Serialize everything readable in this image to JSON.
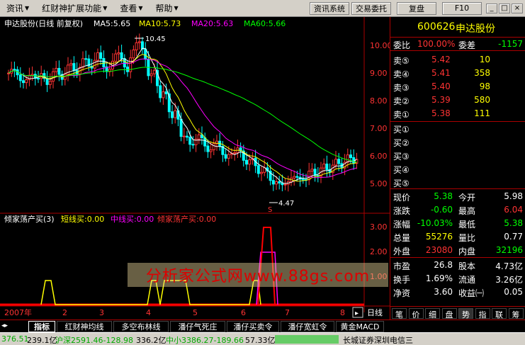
{
  "menu": {
    "items": [
      {
        "label": "资讯",
        "arrow": true
      },
      {
        "label": "红财神扩展功能",
        "arrow": true
      },
      {
        "label": "查看",
        "arrow": true
      },
      {
        "label": "帮助",
        "arrow": true
      }
    ],
    "buttons": [
      "资讯系统",
      "交易委托",
      "复盘",
      "F10"
    ],
    "window_controls": [
      "_",
      "□",
      "×"
    ]
  },
  "chart_header": {
    "title": "申达股份(日线 前复权)",
    "ma5": "MA5:5.65",
    "ma10": "MA10:5.73",
    "ma20": "MA20:5.63",
    "ma60": "MA60:5.66"
  },
  "indicator_header": {
    "name": "倾家荡产买(3)",
    "short": "短线买:0.00",
    "mid": "中线买:0.00",
    "long": "倾家荡产买:0.00"
  },
  "annotations": {
    "high": "10.45",
    "low": "4.47",
    "marker": "S"
  },
  "axis": {
    "price_ticks": [
      "10.00",
      "9.00",
      "8.00",
      "7.00",
      "6.00",
      "5.00"
    ],
    "ind_ticks": [
      "3.00",
      "2.00",
      "1.00"
    ],
    "dates": [
      "2007年",
      "2",
      "3",
      "4",
      "5",
      "6",
      "7",
      "8"
    ],
    "period": "日线"
  },
  "watermark": "分析家公式网www.88gs.com",
  "quote": {
    "code": "600626",
    "name": "申达股份",
    "wei_bi_label": "委比",
    "wei_bi": "100.00%",
    "wei_cha_label": "委差",
    "wei_cha": "-1157",
    "sell": [
      {
        "label": "卖⑤",
        "price": "5.42",
        "vol": "10"
      },
      {
        "label": "卖④",
        "price": "5.41",
        "vol": "358"
      },
      {
        "label": "卖③",
        "price": "5.40",
        "vol": "98"
      },
      {
        "label": "卖②",
        "price": "5.39",
        "vol": "580"
      },
      {
        "label": "卖①",
        "price": "5.38",
        "vol": "111"
      }
    ],
    "buy": [
      {
        "label": "买①"
      },
      {
        "label": "买②"
      },
      {
        "label": "买③"
      },
      {
        "label": "买④"
      },
      {
        "label": "买⑤"
      }
    ],
    "stats": [
      {
        "l1": "现价",
        "v1": "5.38",
        "c1": "#0f0",
        "l2": "今开",
        "v2": "5.98",
        "c2": "#fff"
      },
      {
        "l1": "涨跌",
        "v1": "-0.60",
        "c1": "#0f0",
        "l2": "最高",
        "v2": "6.04",
        "c2": "#f33"
      },
      {
        "l1": "涨幅",
        "v1": "-10.03%",
        "c1": "#0f0",
        "l2": "最低",
        "v2": "5.38",
        "c2": "#0f0"
      },
      {
        "l1": "总量",
        "v1": "55276",
        "c1": "#ff0",
        "l2": "量比",
        "v2": "0.77",
        "c2": "#fff"
      },
      {
        "l1": "外盘",
        "v1": "23080",
        "c1": "#f33",
        "l2": "内盘",
        "v2": "32196",
        "c2": "#0f0"
      }
    ],
    "finance": [
      {
        "l1": "市盈",
        "v1": "26.8",
        "l2": "股本",
        "v2": "4.73亿"
      },
      {
        "l1": "换手",
        "v1": "1.69%",
        "l2": "流通",
        "v2": "3.26亿"
      },
      {
        "l1": "净资",
        "v1": "3.60",
        "l2": "收益㈠",
        "v2": "0.05"
      }
    ]
  },
  "tabs": [
    "指标",
    "红财神均线",
    "多空布林线",
    "潘仔气死庄",
    "潘仔买卖令",
    "潘仔宽虹令",
    "黄金MACD"
  ],
  "right_tabs": [
    "笔",
    "价",
    "细",
    "盘",
    "势",
    "指",
    "联",
    "筹"
  ],
  "status": {
    "s1": "376.51",
    "s1b": "239.1亿",
    "s2": "沪深2591.46-128.98",
    "s2b": "336.2亿",
    "s3": "中小3386.27-189.66",
    "s3b": "57.33亿",
    "broker": "长城证券深圳电信三"
  },
  "colors": {
    "up": "#f33",
    "down": "#0ff",
    "ma5": "#fff",
    "ma10": "#ff0",
    "ma20": "#f0f",
    "ma60": "#0f0"
  }
}
